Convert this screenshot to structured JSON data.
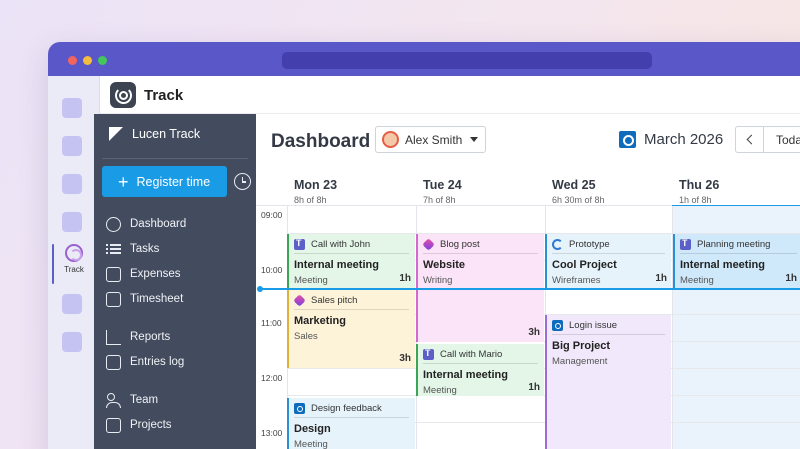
{
  "app": {
    "title": "Track",
    "rail_label": "Track"
  },
  "sidebar": {
    "brand": "Lucen Track",
    "register_label": "Register time",
    "items": [
      {
        "label": "Dashboard",
        "icon": "calendar-clock-icon"
      },
      {
        "label": "Tasks",
        "icon": "checklist-icon"
      },
      {
        "label": "Expenses",
        "icon": "wallet-icon"
      },
      {
        "label": "Timesheet",
        "icon": "timesheet-icon"
      },
      {
        "label": "Reports",
        "icon": "chart-icon"
      },
      {
        "label": "Entries log",
        "icon": "entries-log-icon"
      },
      {
        "label": "Team",
        "icon": "team-icon"
      },
      {
        "label": "Projects",
        "icon": "projects-icon"
      }
    ]
  },
  "header": {
    "title": "Dashboard",
    "user": "Alex Smith",
    "month": "March 2026",
    "today_label": "Toda"
  },
  "days": [
    {
      "name": "Mon 23",
      "total": "8h of 8h"
    },
    {
      "name": "Tue 24",
      "total": "7h of 8h"
    },
    {
      "name": "Wed 25",
      "total": "6h 30m of 8h"
    },
    {
      "name": "Thu 26",
      "total": "1h of 8h"
    }
  ],
  "hours": [
    "09:00",
    "10:00",
    "11:00",
    "12:00",
    "13:00"
  ],
  "events": [
    {
      "source": "Call with John",
      "title": "Internal meeting",
      "tag": "Meeting",
      "duration": "1h",
      "icon": "teams-icon",
      "color": "#e3f6e8",
      "border": "#3aa655"
    },
    {
      "source": "Sales pitch",
      "title": "Marketing",
      "tag": "Sales",
      "duration": "3h",
      "icon": "viva-icon",
      "color": "#fdf3d9",
      "border": "#e0b13a"
    },
    {
      "source": "Design feedback",
      "title": "Design",
      "tag": "Meeting",
      "duration": "",
      "icon": "outlook-icon",
      "color": "#e6f3fb",
      "border": "#2b8fd6"
    },
    {
      "source": "Blog post",
      "title": "Website",
      "tag": "Writing",
      "duration": "3h",
      "icon": "viva-icon",
      "color": "#fbe4f7",
      "border": "#d36ad0"
    },
    {
      "source": "Call with Mario",
      "title": "Internal meeting",
      "tag": "Meeting",
      "duration": "1h",
      "icon": "teams-icon",
      "color": "#e3f6e8",
      "border": "#3aa655"
    },
    {
      "source": "Prototype",
      "title": "Cool Project",
      "tag": "Wireframes",
      "duration": "1h",
      "icon": "loop-icon",
      "color": "#e6f3fb",
      "border": "#2b8fd6"
    },
    {
      "source": "Login issue",
      "title": "Big Project",
      "tag": "Management",
      "duration": "",
      "icon": "outlook-icon",
      "color": "#f1e8fb",
      "border": "#9b6cd6"
    },
    {
      "source": "Planning meeting",
      "title": "Internal meeting",
      "tag": "Meeting",
      "duration": "1h",
      "icon": "teams-icon",
      "color": "#cfe9fb",
      "border": "#2b8fd6"
    }
  ]
}
